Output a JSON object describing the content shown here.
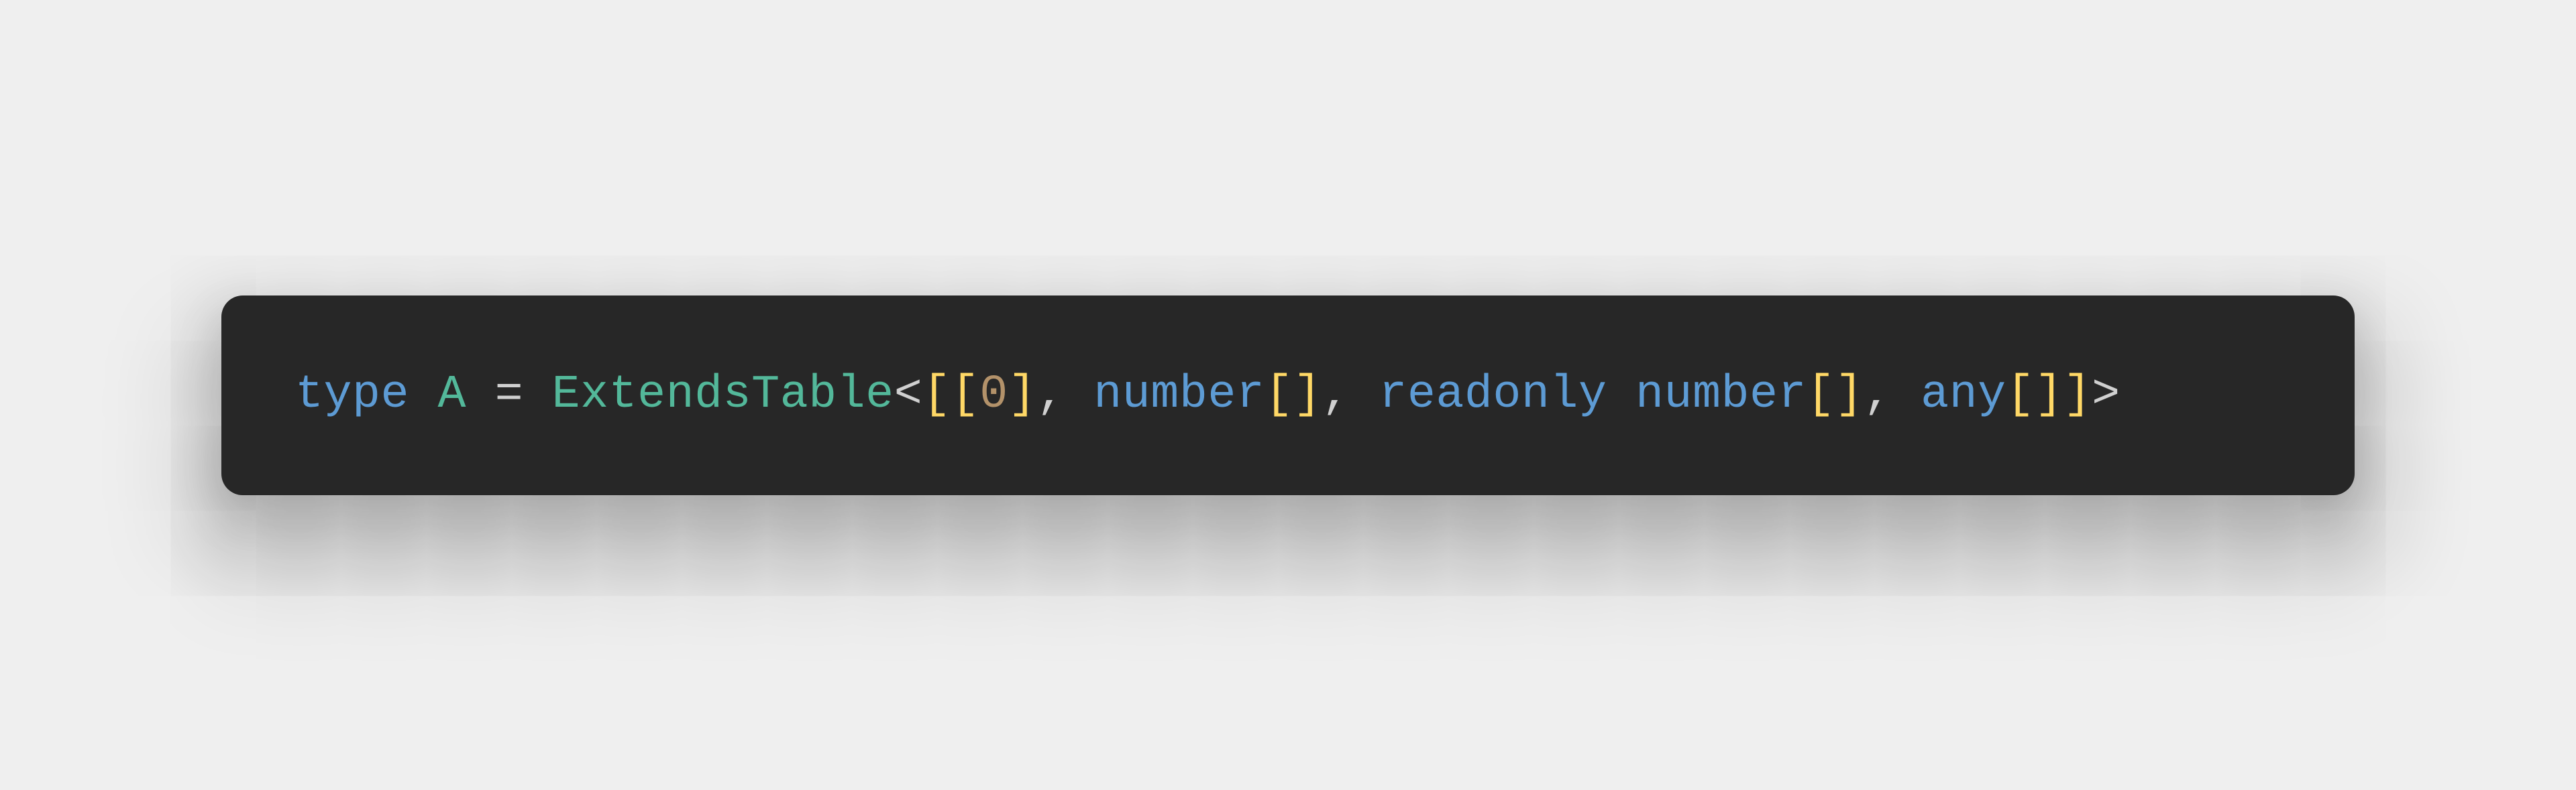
{
  "code": {
    "tokens": [
      {
        "text": "type",
        "class": "keyword"
      },
      {
        "text": " ",
        "class": "punct"
      },
      {
        "text": "A",
        "class": "type-name"
      },
      {
        "text": " ",
        "class": "punct"
      },
      {
        "text": "=",
        "class": "operator"
      },
      {
        "text": " ",
        "class": "punct"
      },
      {
        "text": "ExtendsTable",
        "class": "type-name"
      },
      {
        "text": "<",
        "class": "punct"
      },
      {
        "text": "[[",
        "class": "bracket"
      },
      {
        "text": "0",
        "class": "number"
      },
      {
        "text": "]",
        "class": "bracket"
      },
      {
        "text": ",",
        "class": "punct"
      },
      {
        "text": " ",
        "class": "punct"
      },
      {
        "text": "number",
        "class": "builtin-type"
      },
      {
        "text": "[]",
        "class": "bracket"
      },
      {
        "text": ",",
        "class": "punct"
      },
      {
        "text": " ",
        "class": "punct"
      },
      {
        "text": "readonly",
        "class": "keyword"
      },
      {
        "text": " ",
        "class": "punct"
      },
      {
        "text": "number",
        "class": "builtin-type"
      },
      {
        "text": "[]",
        "class": "bracket"
      },
      {
        "text": ",",
        "class": "punct"
      },
      {
        "text": " ",
        "class": "punct"
      },
      {
        "text": "any",
        "class": "builtin-type"
      },
      {
        "text": "[]]",
        "class": "bracket"
      },
      {
        "text": ">",
        "class": "punct"
      }
    ]
  }
}
